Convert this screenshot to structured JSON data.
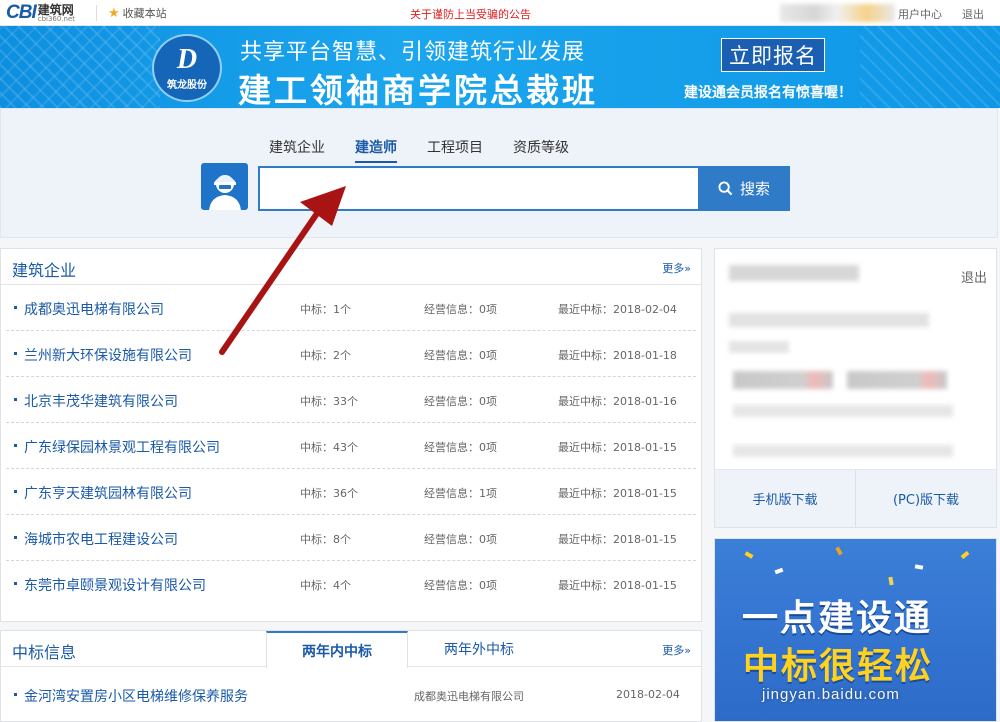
{
  "topbar": {
    "logo_prefix": "CBI",
    "logo_name": "建筑网",
    "logo_url": "cbi360.net",
    "favorite": "收藏本站",
    "notice": "关于谨防上当受骗的公告",
    "user_center": "用户中心",
    "logout": "退出"
  },
  "banner": {
    "logo_brand": "筑龙股份",
    "subtitle": "共享平台智慧、引领建筑行业发展",
    "title": "建工领袖商学院总裁班",
    "button": "立即报名",
    "promo": "建设通会员报名有惊喜喔！"
  },
  "search": {
    "tabs": [
      "建筑企业",
      "建造师",
      "工程项目",
      "资质等级"
    ],
    "active_tab": "建造师",
    "input_value": "",
    "button": "搜索"
  },
  "companies": {
    "title": "建筑企业",
    "more": "更多»",
    "rows": [
      {
        "name": "成都奥迅电梯有限公司",
        "bid": "中标：1个",
        "biz": "经营信息：0项",
        "recent": "最近中标：2018-02-04"
      },
      {
        "name": "兰州新大环保设施有限公司",
        "bid": "中标：2个",
        "biz": "经营信息：0项",
        "recent": "最近中标：2018-01-18"
      },
      {
        "name": "北京丰茂华建筑有限公司",
        "bid": "中标：33个",
        "biz": "经营信息：0项",
        "recent": "最近中标：2018-01-16"
      },
      {
        "name": "广东绿保园林景观工程有限公司",
        "bid": "中标：43个",
        "biz": "经营信息：0项",
        "recent": "最近中标：2018-01-15"
      },
      {
        "name": "广东亨天建筑园林有限公司",
        "bid": "中标：36个",
        "biz": "经营信息：1项",
        "recent": "最近中标：2018-01-15"
      },
      {
        "name": "海城市农电工程建设公司",
        "bid": "中标：8个",
        "biz": "经营信息：0项",
        "recent": "最近中标：2018-01-15"
      },
      {
        "name": "东莞市卓颐景观设计有限公司",
        "bid": "中标：4个",
        "biz": "经营信息：0项",
        "recent": "最近中标：2018-01-15"
      }
    ]
  },
  "bids": {
    "title": "中标信息",
    "tab_active": "两年内中标",
    "tab_inactive": "两年外中标",
    "more": "更多»",
    "row": {
      "name": "金河湾安置房小区电梯维修保养服务",
      "company": "成都奥迅电梯有限公司",
      "date": "2018-02-04"
    }
  },
  "user_panel": {
    "logout": "退出",
    "download_mobile": "手机版下载",
    "download_pc": "(PC)版下载"
  },
  "ad": {
    "line1": "一点建设通",
    "line2": "中标很轻松"
  },
  "watermark": "jingyan.baidu.com",
  "colors": {
    "primary": "#1a5aa8",
    "button": "#2f7bc8",
    "banner": "#1ba6ee",
    "notice": "#e02020",
    "arrow": "#a81414"
  },
  "icons": [
    "star-icon",
    "search-icon",
    "user-avatar-icon",
    "arrow-annotation"
  ]
}
